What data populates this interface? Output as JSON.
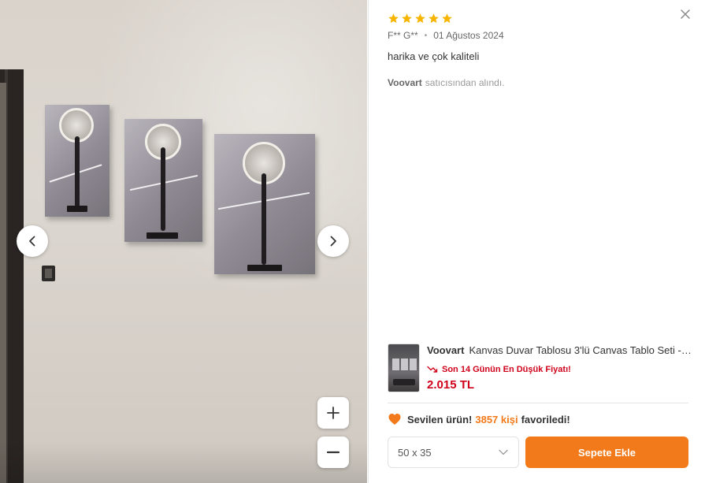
{
  "review": {
    "rating": 5,
    "star_color": "#f7b500",
    "author": "F** G**",
    "separator": "•",
    "date": "01 Ağustos 2024",
    "text": "harika ve çok kaliteli",
    "seller_name": "Voovart",
    "seller_suffix": "satıcısından alındı."
  },
  "product": {
    "brand": "Voovart",
    "title": "Kanvas Duvar Tablosu 3'lü Canvas Tablo Seti - …",
    "low_price_label": "Son 14 Günün En Düşük Fiyatı!",
    "price": "2.015 TL"
  },
  "favorites": {
    "prefix": "Sevilen ürün!",
    "count": "3857 kişi",
    "suffix": "favoriledi!"
  },
  "size_select": {
    "value": "50 x 35"
  },
  "actions": {
    "add_to_cart": "Sepete Ekle"
  },
  "icons": {
    "close": "close-icon",
    "prev": "chevron-left-icon",
    "next": "chevron-right-icon",
    "zoom_in": "plus-icon",
    "zoom_out": "minus-icon",
    "favorite": "heart-icon",
    "price_drop": "trend-down-icon",
    "dropdown": "chevron-down-icon"
  },
  "colors": {
    "accent": "#f27a1a",
    "price_red": "#d0021b"
  }
}
